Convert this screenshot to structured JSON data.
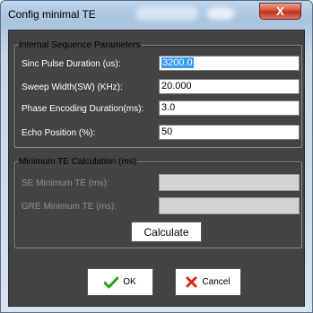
{
  "window": {
    "title": "Config minimal TE",
    "close_glyph": "X"
  },
  "internal_group": {
    "legend": "Internal Sequence Parameters",
    "fields": [
      {
        "label": "Sinc Pulse Duration (us):",
        "value": "3200.0",
        "selected": true
      },
      {
        "label": "Sweep Width(SW) (KHz):",
        "value": "20.000"
      },
      {
        "label": "Phase Encoding Duration(ms):",
        "value": "3.0"
      },
      {
        "label": "Echo Position (%):",
        "value": "50"
      }
    ]
  },
  "te_group": {
    "legend": "Minimum TE Calculation (ms)",
    "fields": [
      {
        "label": "SE Minimum TE (ms):",
        "value": ""
      },
      {
        "label": "GRE Minimum TE (ms):",
        "value": ""
      }
    ],
    "calculate_label": "Calculate"
  },
  "buttons": {
    "ok_label": "OK",
    "ok_icon": "green-checkmark-icon",
    "cancel_label": "Cancel",
    "cancel_icon": "red-x-icon"
  },
  "colors": {
    "panel_bg": "#444444",
    "label_text": "#ffffff",
    "disabled_label": "#8e8e8e",
    "selection": "#3399ff",
    "ok_icon": "#2a9d1c",
    "cancel_icon": "#d9241b"
  }
}
